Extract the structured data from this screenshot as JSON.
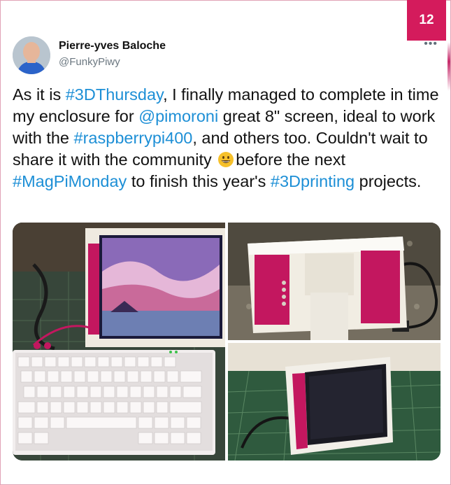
{
  "page_number": "12",
  "author": {
    "name": "Pierre-yves Baloche",
    "handle": "@FunkyPiwy"
  },
  "more_icon": "ellipsis-icon",
  "tweet": {
    "segments": [
      {
        "text": "As it is ",
        "type": "text"
      },
      {
        "text": "#3DThursday",
        "type": "hashtag"
      },
      {
        "text": ", I finally managed to complete in time my enclosure for ",
        "type": "text"
      },
      {
        "text": "@pimoroni",
        "type": "mention"
      },
      {
        "text": " great 8\" screen, ideal to work with the ",
        "type": "text"
      },
      {
        "text": "#raspberrypi400",
        "type": "hashtag"
      },
      {
        "text": ", and others too. Couldn't wait to share it with the community ",
        "type": "text"
      },
      {
        "text": "before the next ",
        "type": "text"
      },
      {
        "text": "#MagPiMonday",
        "type": "hashtag"
      },
      {
        "text": " to finish this year's ",
        "type": "text"
      },
      {
        "text": "#3Dprinting",
        "type": "hashtag"
      },
      {
        "text": " projects.",
        "type": "text"
      }
    ],
    "emoji": "grinning-face-emoji"
  },
  "colors": {
    "accent_badge": "#d41b5c",
    "link": "#1d8fd6",
    "enclosure_pink": "#c3175f"
  },
  "media": [
    {
      "name": "photo-screen-with-keyboard"
    },
    {
      "name": "photo-enclosure-rear"
    },
    {
      "name": "photo-enclosure-angled"
    }
  ]
}
